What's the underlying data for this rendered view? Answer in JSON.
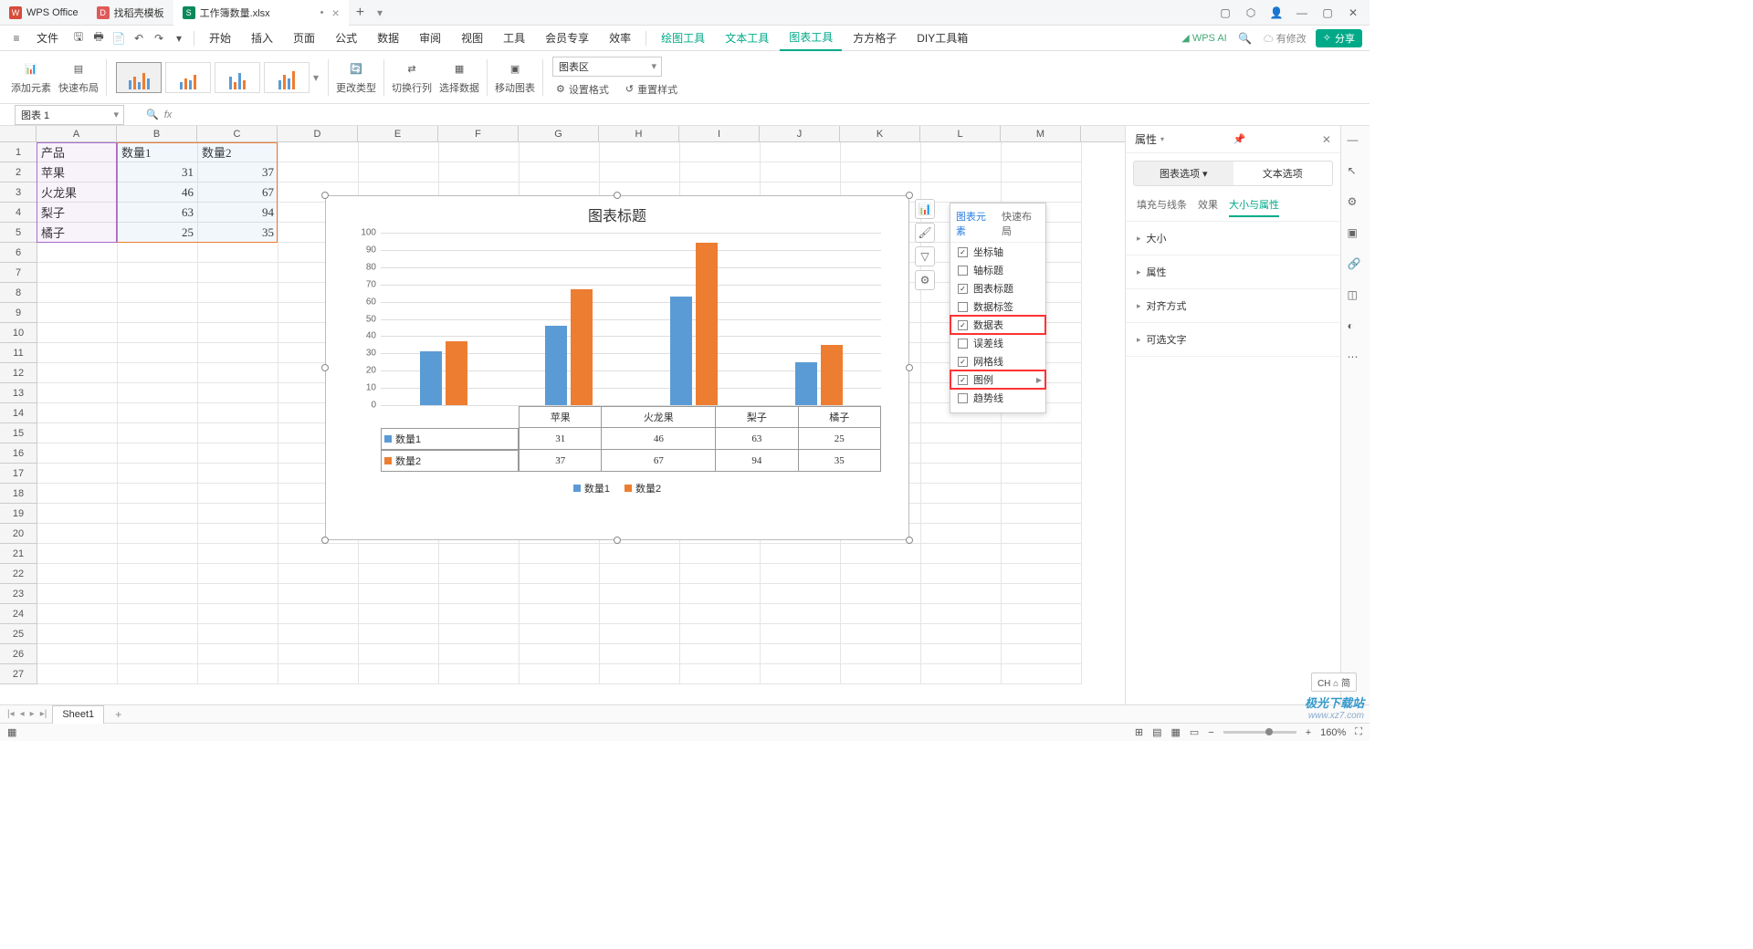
{
  "titlebar": {
    "tabs": [
      {
        "icon_bg": "#d94b3a",
        "icon_text": "W",
        "label": "WPS Office"
      },
      {
        "icon_bg": "#e05a5a",
        "icon_text": "D",
        "label": "找稻壳模板"
      },
      {
        "icon_bg": "#0a8a5a",
        "icon_text": "S",
        "label": "工作簿数量.xlsx",
        "active": true,
        "dirty": "•"
      }
    ],
    "add": "+"
  },
  "menubar": {
    "file": "文件",
    "tabs": [
      "开始",
      "插入",
      "页面",
      "公式",
      "数据",
      "审阅",
      "视图",
      "工具",
      "会员专享",
      "效率"
    ],
    "green_tabs": [
      "绘图工具",
      "文本工具",
      "图表工具",
      "方方格子",
      "DIY工具箱"
    ],
    "active_tab": "图表工具",
    "right": {
      "wpsai": "WPS AI",
      "modify": "有修改",
      "share": "分享"
    }
  },
  "ribbon": {
    "add_element": "添加元素",
    "quick_layout": "快速布局",
    "change_type": "更改类型",
    "switch_rc": "切换行列",
    "select_data": "选择数据",
    "move_chart": "移动图表",
    "area_label": "图表区",
    "set_format": "设置格式",
    "reset_style": "重置样式"
  },
  "formula_bar": {
    "name": "图表 1",
    "fx": "fx"
  },
  "grid": {
    "cols": [
      "A",
      "B",
      "C",
      "D",
      "E",
      "F",
      "G",
      "H",
      "I",
      "J",
      "K",
      "L",
      "M"
    ],
    "rows": 27,
    "data": [
      [
        "产品",
        "数量1",
        "数量2"
      ],
      [
        "苹果",
        "31",
        "37"
      ],
      [
        "火龙果",
        "46",
        "67"
      ],
      [
        "梨子",
        "63",
        "94"
      ],
      [
        "橘子",
        "25",
        "35"
      ]
    ]
  },
  "chart_data": {
    "type": "bar",
    "title": "图表标题",
    "categories": [
      "苹果",
      "火龙果",
      "梨子",
      "橘子"
    ],
    "series": [
      {
        "name": "数量1",
        "values": [
          31,
          46,
          63,
          25
        ],
        "color": "#5b9bd5"
      },
      {
        "name": "数量2",
        "values": [
          37,
          67,
          94,
          35
        ],
        "color": "#ed7d31"
      }
    ],
    "ylim": [
      0,
      100
    ],
    "yticks": [
      0,
      10,
      20,
      30,
      40,
      50,
      60,
      70,
      80,
      90,
      100
    ],
    "data_table": true,
    "legend": true
  },
  "elements_popup": {
    "tabs": [
      "图表元素",
      "快速布局"
    ],
    "active_tab": "图表元素",
    "items": [
      {
        "label": "坐标轴",
        "checked": true
      },
      {
        "label": "轴标题",
        "checked": false
      },
      {
        "label": "图表标题",
        "checked": true
      },
      {
        "label": "数据标签",
        "checked": false
      },
      {
        "label": "数据表",
        "checked": true,
        "highlight": true
      },
      {
        "label": "误差线",
        "checked": false
      },
      {
        "label": "网格线",
        "checked": true
      },
      {
        "label": "图例",
        "checked": true,
        "highlight": true,
        "arrow": true
      },
      {
        "label": "趋势线",
        "checked": false
      }
    ]
  },
  "right_panel": {
    "title": "属性",
    "tabs": [
      "图表选项",
      "文本选项"
    ],
    "active_tab": "图表选项",
    "subtabs": [
      "填充与线条",
      "效果",
      "大小与属性"
    ],
    "active_subtab": "大小与属性",
    "sections": [
      "大小",
      "属性",
      "对齐方式",
      "可选文字"
    ]
  },
  "sheet_tabs": {
    "active": "Sheet1",
    "add": "+"
  },
  "status": {
    "zoom": "160%",
    "ime": "CH ⌂ 简"
  },
  "watermark": {
    "t1": "极光下载站",
    "t2": "www.xz7.com"
  }
}
